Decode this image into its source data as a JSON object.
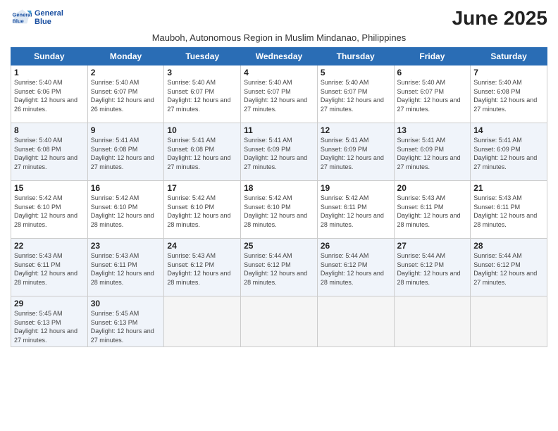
{
  "logo": {
    "line1": "General",
    "line2": "Blue"
  },
  "title": "June 2025",
  "subtitle": "Mauboh, Autonomous Region in Muslim Mindanao, Philippines",
  "weekdays": [
    "Sunday",
    "Monday",
    "Tuesday",
    "Wednesday",
    "Thursday",
    "Friday",
    "Saturday"
  ],
  "weeks": [
    [
      {
        "num": "1",
        "rise": "5:40 AM",
        "set": "6:06 PM",
        "dh": "12 hours and 26 minutes."
      },
      {
        "num": "2",
        "rise": "5:40 AM",
        "set": "6:07 PM",
        "dh": "12 hours and 26 minutes."
      },
      {
        "num": "3",
        "rise": "5:40 AM",
        "set": "6:07 PM",
        "dh": "12 hours and 27 minutes."
      },
      {
        "num": "4",
        "rise": "5:40 AM",
        "set": "6:07 PM",
        "dh": "12 hours and 27 minutes."
      },
      {
        "num": "5",
        "rise": "5:40 AM",
        "set": "6:07 PM",
        "dh": "12 hours and 27 minutes."
      },
      {
        "num": "6",
        "rise": "5:40 AM",
        "set": "6:07 PM",
        "dh": "12 hours and 27 minutes."
      },
      {
        "num": "7",
        "rise": "5:40 AM",
        "set": "6:08 PM",
        "dh": "12 hours and 27 minutes."
      }
    ],
    [
      {
        "num": "8",
        "rise": "5:40 AM",
        "set": "6:08 PM",
        "dh": "12 hours and 27 minutes."
      },
      {
        "num": "9",
        "rise": "5:41 AM",
        "set": "6:08 PM",
        "dh": "12 hours and 27 minutes."
      },
      {
        "num": "10",
        "rise": "5:41 AM",
        "set": "6:08 PM",
        "dh": "12 hours and 27 minutes."
      },
      {
        "num": "11",
        "rise": "5:41 AM",
        "set": "6:09 PM",
        "dh": "12 hours and 27 minutes."
      },
      {
        "num": "12",
        "rise": "5:41 AM",
        "set": "6:09 PM",
        "dh": "12 hours and 27 minutes."
      },
      {
        "num": "13",
        "rise": "5:41 AM",
        "set": "6:09 PM",
        "dh": "12 hours and 27 minutes."
      },
      {
        "num": "14",
        "rise": "5:41 AM",
        "set": "6:09 PM",
        "dh": "12 hours and 27 minutes."
      }
    ],
    [
      {
        "num": "15",
        "rise": "5:42 AM",
        "set": "6:10 PM",
        "dh": "12 hours and 28 minutes."
      },
      {
        "num": "16",
        "rise": "5:42 AM",
        "set": "6:10 PM",
        "dh": "12 hours and 28 minutes."
      },
      {
        "num": "17",
        "rise": "5:42 AM",
        "set": "6:10 PM",
        "dh": "12 hours and 28 minutes."
      },
      {
        "num": "18",
        "rise": "5:42 AM",
        "set": "6:10 PM",
        "dh": "12 hours and 28 minutes."
      },
      {
        "num": "19",
        "rise": "5:42 AM",
        "set": "6:11 PM",
        "dh": "12 hours and 28 minutes."
      },
      {
        "num": "20",
        "rise": "5:43 AM",
        "set": "6:11 PM",
        "dh": "12 hours and 28 minutes."
      },
      {
        "num": "21",
        "rise": "5:43 AM",
        "set": "6:11 PM",
        "dh": "12 hours and 28 minutes."
      }
    ],
    [
      {
        "num": "22",
        "rise": "5:43 AM",
        "set": "6:11 PM",
        "dh": "12 hours and 28 minutes."
      },
      {
        "num": "23",
        "rise": "5:43 AM",
        "set": "6:11 PM",
        "dh": "12 hours and 28 minutes."
      },
      {
        "num": "24",
        "rise": "5:43 AM",
        "set": "6:12 PM",
        "dh": "12 hours and 28 minutes."
      },
      {
        "num": "25",
        "rise": "5:44 AM",
        "set": "6:12 PM",
        "dh": "12 hours and 28 minutes."
      },
      {
        "num": "26",
        "rise": "5:44 AM",
        "set": "6:12 PM",
        "dh": "12 hours and 28 minutes."
      },
      {
        "num": "27",
        "rise": "5:44 AM",
        "set": "6:12 PM",
        "dh": "12 hours and 28 minutes."
      },
      {
        "num": "28",
        "rise": "5:44 AM",
        "set": "6:12 PM",
        "dh": "12 hours and 27 minutes."
      }
    ],
    [
      {
        "num": "29",
        "rise": "5:45 AM",
        "set": "6:13 PM",
        "dh": "12 hours and 27 minutes."
      },
      {
        "num": "30",
        "rise": "5:45 AM",
        "set": "6:13 PM",
        "dh": "12 hours and 27 minutes."
      },
      null,
      null,
      null,
      null,
      null
    ]
  ]
}
